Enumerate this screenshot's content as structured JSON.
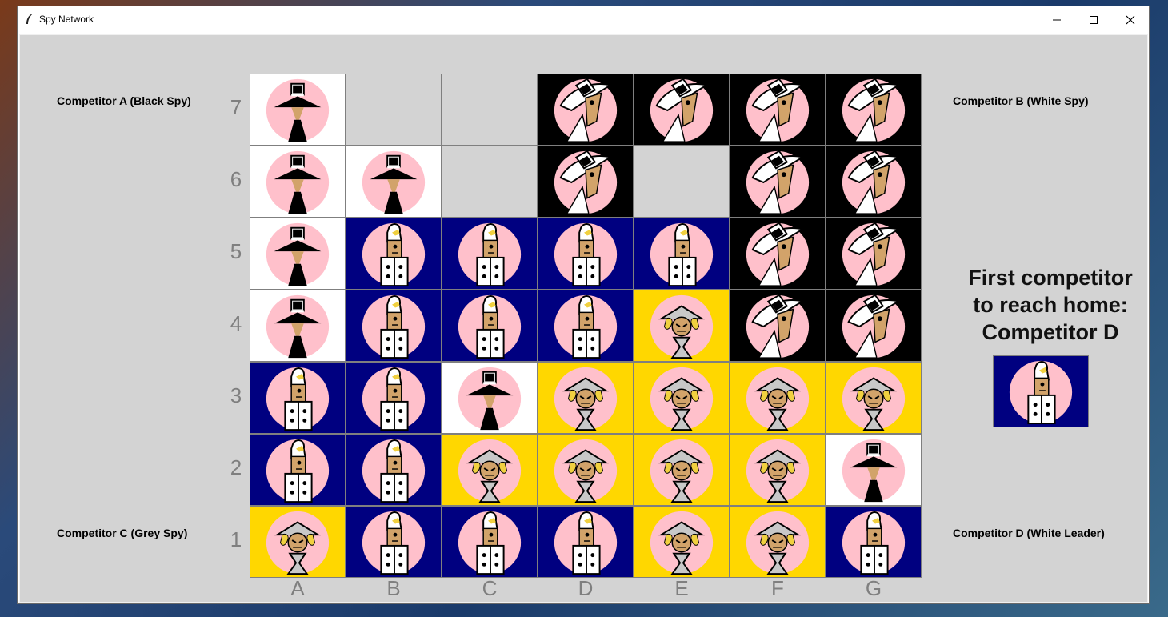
{
  "window": {
    "title": "Spy Network"
  },
  "labels": {
    "a": "Competitor A (Black Spy)",
    "b": "Competitor B (White Spy)",
    "c": "Competitor C (Grey Spy)",
    "d": "Competitor D (White Leader)"
  },
  "board": {
    "files": [
      "A",
      "B",
      "C",
      "D",
      "E",
      "F",
      "G"
    ],
    "ranks": [
      "7",
      "6",
      "5",
      "4",
      "3",
      "2",
      "1"
    ],
    "rows": [
      [
        "black",
        "empty",
        "empty",
        "white",
        "white",
        "white",
        "white"
      ],
      [
        "black",
        "black",
        "empty",
        "white",
        "empty",
        "white",
        "white"
      ],
      [
        "black",
        "leader",
        "leader",
        "leader",
        "leader",
        "white",
        "white"
      ],
      [
        "black",
        "leader",
        "leader",
        "leader",
        "grey",
        "white",
        "white"
      ],
      [
        "leader",
        "leader",
        "black",
        "grey",
        "grey",
        "grey",
        "grey"
      ],
      [
        "leader",
        "leader",
        "grey",
        "grey",
        "grey",
        "grey",
        "black"
      ],
      [
        "grey",
        "leader",
        "leader",
        "leader",
        "grey",
        "grey",
        "leader"
      ]
    ]
  },
  "winner": {
    "line1": "First competitor",
    "line2": "to reach home:",
    "line3": "Competitor D",
    "piece": "leader"
  },
  "colors": {
    "black_bg": "#ffffff",
    "white_bg": "#000000",
    "grey_bg": "#ffd700",
    "leader_bg": "#000080",
    "empty_bg": "#d3d3d3",
    "face": "#ffc0cb"
  },
  "icons": {
    "black": "black-spy-icon",
    "white": "white-spy-icon",
    "grey": "grey-spy-icon",
    "leader": "white-leader-icon"
  }
}
